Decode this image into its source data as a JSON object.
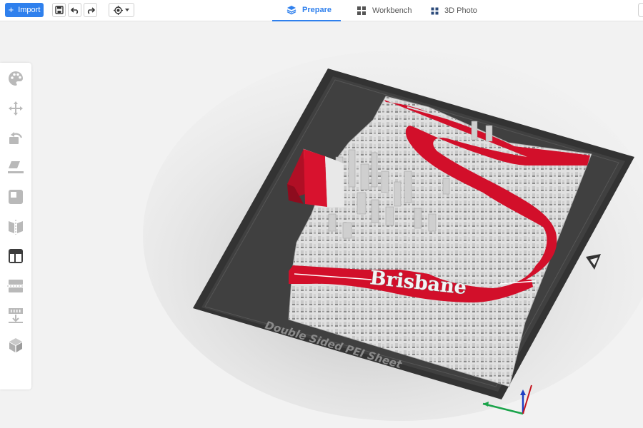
{
  "toolbar": {
    "import_label": "Import",
    "plus_symbol": "+",
    "buttons": [
      "save-icon",
      "undo-icon",
      "redo-icon"
    ],
    "view_selector_icon": "view-icon"
  },
  "tabs": [
    {
      "label": "Prepare",
      "icon": "layers-icon",
      "active": true
    },
    {
      "label": "Workbench",
      "icon": "workbench-icon",
      "active": false
    },
    {
      "label": "3D Photo",
      "icon": "grid-dots-icon",
      "active": false
    }
  ],
  "left_tools": [
    "palette-icon",
    "move-icon",
    "rotate-icon",
    "place-on-face-icon",
    "scale-icon",
    "mirror-icon",
    "layout-icon",
    "cut-icon",
    "support-icon",
    "box-icon"
  ],
  "model": {
    "city_name": "Brisbane",
    "plate_text": "Double Sided PEI Sheet",
    "colors": {
      "river": "#d20f2a",
      "buildings": "#e2e2e2",
      "plate": "#3a3a3a",
      "accent": "#2f80ed"
    }
  }
}
